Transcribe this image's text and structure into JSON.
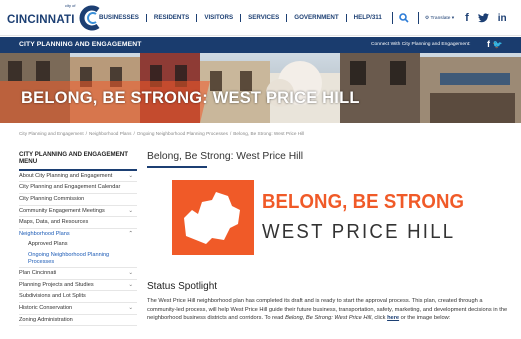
{
  "header": {
    "logo": {
      "city_of": "city of",
      "name": "CINCINNATI"
    },
    "nav": [
      "BUSINESSES",
      "RESIDENTS",
      "VISITORS",
      "SERVICES",
      "GOVERNMENT",
      "HELP/311"
    ],
    "translate": "Translate ▾",
    "colors": {
      "brand": "#1c3f73",
      "accent": "#f05a28"
    }
  },
  "dept": {
    "title": "CITY PLANNING AND ENGAGEMENT",
    "connect": "Connect With City Planning and Engagement:"
  },
  "hero": {
    "title": "BELONG, BE STRONG: WEST PRICE HILL"
  },
  "breadcrumb": [
    "City Planning and Engagement",
    "Neighborhood Plans",
    "Ongoing Neighborhood Planning Processes",
    "Belong, Be Strong: West Price Hill"
  ],
  "sidebar": {
    "heading": "CITY PLANNING AND ENGAGEMENT MENU",
    "items": [
      {
        "label": "About City Planning and Engagement",
        "chevron": "⌄"
      },
      {
        "label": "City Planning and Engagement Calendar"
      },
      {
        "label": "City Planning Commission"
      },
      {
        "label": "Community Engagement Meetings",
        "chevron": "⌄"
      },
      {
        "label": "Maps, Data, and Resources"
      },
      {
        "label": "Neighborhood Plans",
        "chevron": "⌃"
      },
      {
        "label": "Approved Plans"
      },
      {
        "label": "Ongoing Neighborhood Planning Processes"
      },
      {
        "label": "Plan Cincinnati",
        "chevron": "⌄"
      },
      {
        "label": "Planning Projects and Studies",
        "chevron": "⌄"
      },
      {
        "label": "Subdivisions and Lot Splits"
      },
      {
        "label": "Historic Conservation",
        "chevron": "⌄"
      },
      {
        "label": "Zoning Administration"
      }
    ]
  },
  "main": {
    "title": "Belong, Be Strong: West Price Hill",
    "banner": {
      "line1": "BELONG, BE STRONG",
      "line2": "WEST PRICE HILL"
    },
    "status_title": "Status Spotlight",
    "status_body_1": "The West Price Hill neighborhood plan has completed its draft and is ready to start the approval process. This plan, created through a community-led process, will help West Price Hill guide their future business, transportation, safety, marketing, and development decisions in the neighborhood business districts and corridors. To read ",
    "status_body_em": "Belong, Be Strong: West Price Hill",
    "status_body_2": ", click ",
    "status_link": "here",
    "status_body_3": " or the image below:"
  }
}
